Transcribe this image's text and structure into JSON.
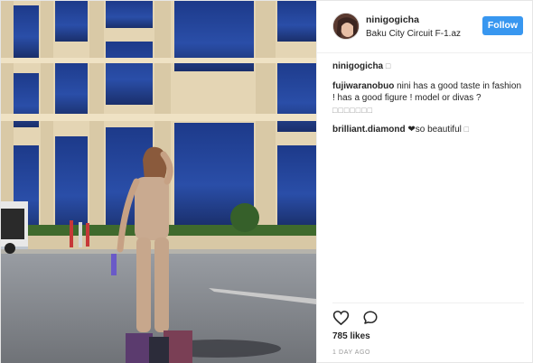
{
  "post": {
    "username": "ninigogicha",
    "location": "Baku City Circuit F-1.az",
    "follow_label": "Follow"
  },
  "comments": [
    {
      "user": "ninigogicha",
      "text": "",
      "extra": "□"
    },
    {
      "user": "fujiwaranobuo",
      "text": "nini has a good taste in fashion ! has a good figure ! model or divas ?",
      "extra": "□□□□□□□"
    },
    {
      "user": "brilliant.diamond",
      "text": "❤so beautiful",
      "extra": "□"
    }
  ],
  "actions": {
    "like_icon": "heart-outline-icon",
    "comment_icon": "speech-bubble-icon"
  },
  "likes_label": "785 likes",
  "timestamp": "1 DAY AGO",
  "colors": {
    "follow_button": "#3897f0",
    "text": "#262626",
    "muted": "#999999",
    "divider": "#efefef"
  }
}
